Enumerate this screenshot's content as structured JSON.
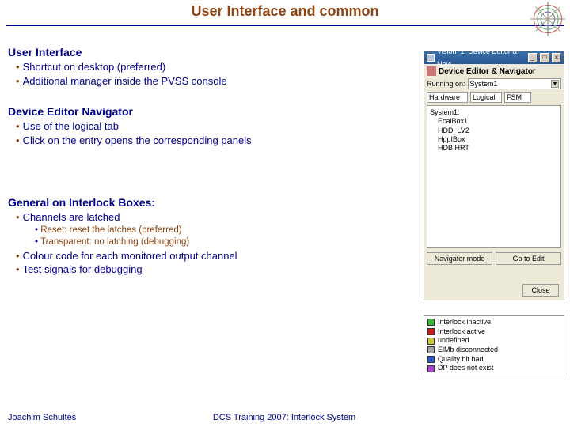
{
  "title": "User Interface and common",
  "sections": {
    "ui": {
      "heading": "User Interface",
      "b1": "Shortcut on desktop (preferred)",
      "b2": "Additional manager inside the PVSS console"
    },
    "den": {
      "heading": "Device Editor Navigator",
      "b1": "Use of the logical tab",
      "b2": "Click on the entry opens the corresponding panels"
    },
    "gib": {
      "heading": "General on Interlock Boxes:",
      "b1": "Channels are latched",
      "s1": "Reset: reset the latches (preferred)",
      "s2": "Transparent: no latching (debugging)",
      "b2": "Colour code for each monitored output channel",
      "b3": "Test signals for debugging"
    }
  },
  "panel": {
    "window_title": "Vision_1: Device Editor & Navi...",
    "header": "Device Editor & Navigator",
    "running_on_label": "Running on:",
    "running_on_value": "System1",
    "tabs": {
      "hardware": "Hardware",
      "logical": "Logical",
      "fsm": "FSM"
    },
    "tree": {
      "root": "System1:",
      "n1": "EcalBox1",
      "n2": "HDD_LV2",
      "n3": "HppIBox",
      "n4": "HDB HRT"
    },
    "btn_navigator": "Navigator mode",
    "btn_goto": "Go to Edit",
    "btn_close": "Close"
  },
  "legend": {
    "l1": "Interlock inactive",
    "l2": "Interlock active",
    "l3": "undefined",
    "l4": "ElMb disconnected",
    "l5": "Quality bit bad",
    "l6": "DP does not exist",
    "colors": {
      "c1": "#2fbf2f",
      "c2": "#d11a1a",
      "c3": "#c9c92a",
      "c4": "#a0a0a0",
      "c5": "#2d5bd1",
      "c6": "#b03fd6"
    }
  },
  "footer": {
    "left": "Joachim Schultes",
    "center": "DCS Training 2007: Interlock System"
  }
}
